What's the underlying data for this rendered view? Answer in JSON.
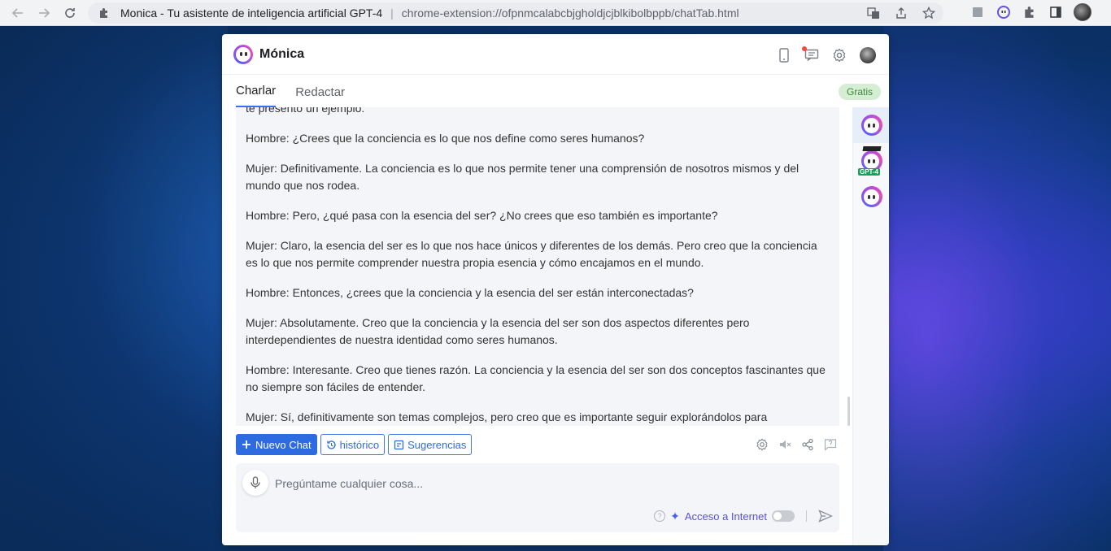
{
  "browser": {
    "tab_title": "Monica - Tu asistente de inteligencia artificial GPT-4",
    "separator": "|",
    "url": "chrome-extension://ofpnmcalabcbjgholdjcjblkibolbppb/chatTab.html"
  },
  "app": {
    "name": "Mónica",
    "plan_badge": "Gratis"
  },
  "tabs": [
    {
      "label": "Charlar",
      "active": true
    },
    {
      "label": "Redactar",
      "active": false
    }
  ],
  "conversation": {
    "paragraphs": [
      "te presento un ejemplo:",
      "Hombre: ¿Crees que la conciencia es lo que nos define como seres humanos?",
      "Mujer: Definitivamente. La conciencia es lo que nos permite tener una comprensión de nosotros mismos y del mundo que nos rodea.",
      "Hombre: Pero, ¿qué pasa con la esencia del ser? ¿No crees que eso también es importante?",
      "Mujer: Claro, la esencia del ser es lo que nos hace únicos y diferentes de los demás. Pero creo que la conciencia es lo que nos permite comprender nuestra propia esencia y cómo encajamos en el mundo.",
      "Hombre: Entonces, ¿crees que la conciencia y la esencia del ser están interconectadas?",
      "Mujer: Absolutamente. Creo que la conciencia y la esencia del ser son dos aspectos diferentes pero interdependientes de nuestra identidad como seres humanos.",
      "Hombre: Interesante. Creo que tienes razón. La conciencia y la esencia del ser son dos conceptos fascinantes que no siempre son fáciles de entender.",
      "Mujer: Sí, definitivamente son temas complejos, pero creo que es importante seguir explorándolos para comprender"
    ]
  },
  "side_rail": {
    "gpt4_tag": "GPT-4"
  },
  "actions": {
    "new_chat": "Nuevo Chat",
    "history": "histórico",
    "suggestions": "Sugerencias"
  },
  "input": {
    "placeholder": "Pregúntame cualquier cosa...",
    "internet_label": "Acceso a Internet",
    "internet_enabled": false
  },
  "colors": {
    "accent": "#2f6be0",
    "badge_bg": "#d4edd3",
    "badge_text": "#3c8a3a",
    "internet_label": "#5b4fdc"
  }
}
